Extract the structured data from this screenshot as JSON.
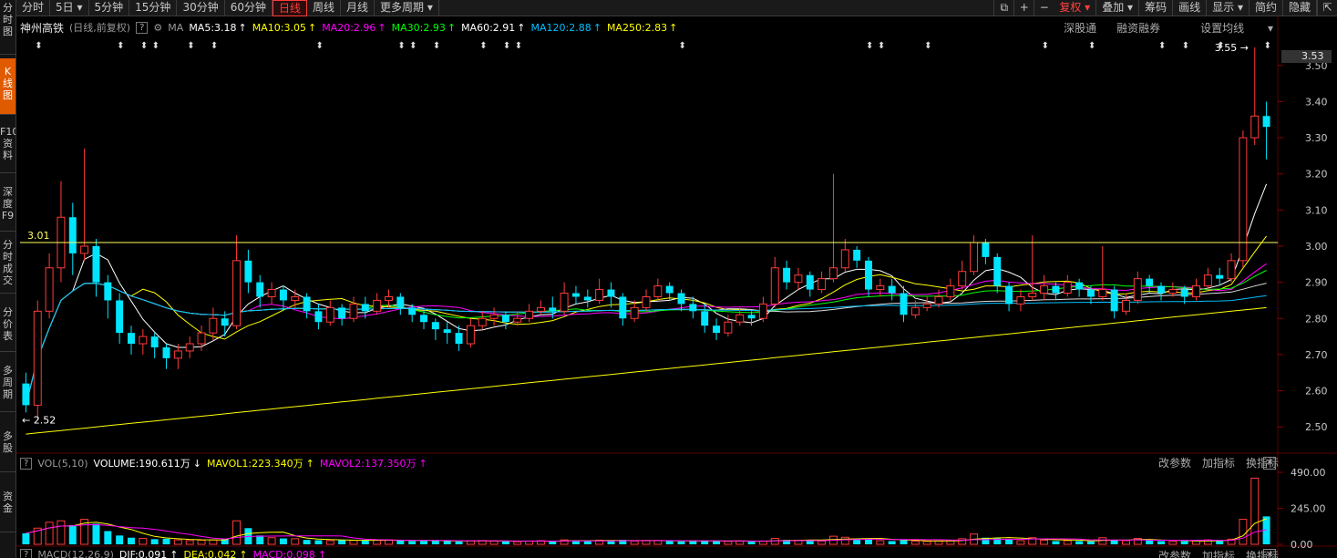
{
  "toolbar": {
    "tabs": [
      "分时",
      "5日",
      "5分钟",
      "15分钟",
      "30分钟",
      "60分钟",
      "日线",
      "周线",
      "月线",
      "更多周期"
    ],
    "active_tab": "日线",
    "right_buttons": [
      "复权",
      "叠加",
      "筹码",
      "画线",
      "显示",
      "简约",
      "隐藏"
    ],
    "accent": "#ff3b3b"
  },
  "sidebar": {
    "tabs": [
      "分时图",
      "K线图",
      "F10资料",
      "深度F9",
      "分时成交",
      "分价表",
      "多周期",
      "多股",
      "资金"
    ],
    "active": "K线图"
  },
  "info": {
    "stock_name": "神州高铁",
    "period": "(日线,前复权)",
    "ma_label": "MA",
    "ma5": "MA5:3.18",
    "ma10": "MA10:3.05",
    "ma20": "MA20:2.96",
    "ma30": "MA30:2.93",
    "ma60": "MA60:2.91",
    "ma120": "MA120:2.88",
    "ma250": "MA250:2.83",
    "right_links": [
      "深股通",
      "融资融券",
      "设置均线"
    ]
  },
  "colors": {
    "up": "#ff3b3b",
    "down": "#00e5ff",
    "ma5": "#ffffff",
    "ma10": "#ffff00",
    "ma20": "#ff00ff",
    "ma30": "#00ff00",
    "ma60": "#ffffff",
    "ma120": "#00bfff",
    "ma250": "#ffff00",
    "hline": "#ffff60"
  },
  "price_panel": {
    "y_ticks": [
      "3.50",
      "3.40",
      "3.30",
      "3.20",
      "3.10",
      "3.00",
      "2.90",
      "2.80",
      "2.70",
      "2.60",
      "2.50"
    ],
    "current_price": "3.53",
    "high_label": "3.55",
    "low_label": "2.52",
    "hline_label": "3.01"
  },
  "vol_panel": {
    "name": "VOL(5,10)",
    "volume": "VOLUME:190.611万",
    "mavol1": "MAVOL1:223.340万",
    "mavol2": "MAVOL2:137.350万",
    "y_ticks": [
      "490.00",
      "245.00",
      "0.00"
    ],
    "links": [
      "改参数",
      "加指标",
      "换指标"
    ]
  },
  "macd_panel": {
    "name": "MACD(12,26,9)",
    "dif": "DIF:0.091",
    "dea": "DEA:0.042",
    "macd": "MACD:0.098",
    "links": [
      "改参数",
      "加指标",
      "换指标"
    ]
  },
  "chart_data": {
    "type": "candlestick",
    "price_range": [
      2.45,
      3.56
    ],
    "volume_range": [
      0,
      490
    ],
    "candles": [
      [
        2.62,
        2.56,
        2.65,
        2.54
      ],
      [
        2.56,
        2.82,
        2.85,
        2.52
      ],
      [
        2.82,
        2.94,
        2.98,
        2.8
      ],
      [
        2.94,
        3.08,
        3.18,
        2.9
      ],
      [
        3.08,
        2.98,
        3.12,
        2.92
      ],
      [
        2.98,
        3.0,
        3.27,
        2.96
      ],
      [
        3.0,
        2.9,
        3.02,
        2.86
      ],
      [
        2.9,
        2.85,
        2.92,
        2.8
      ],
      [
        2.85,
        2.76,
        2.87,
        2.73
      ],
      [
        2.76,
        2.73,
        2.78,
        2.7
      ],
      [
        2.73,
        2.75,
        2.77,
        2.7
      ],
      [
        2.75,
        2.72,
        2.76,
        2.69
      ],
      [
        2.72,
        2.69,
        2.73,
        2.66
      ],
      [
        2.69,
        2.71,
        2.73,
        2.66
      ],
      [
        2.71,
        2.73,
        2.75,
        2.69
      ],
      [
        2.73,
        2.76,
        2.78,
        2.71
      ],
      [
        2.76,
        2.8,
        2.83,
        2.74
      ],
      [
        2.8,
        2.78,
        2.82,
        2.75
      ],
      [
        2.78,
        2.96,
        3.03,
        2.77
      ],
      [
        2.96,
        2.9,
        2.99,
        2.87
      ],
      [
        2.9,
        2.86,
        2.92,
        2.83
      ],
      [
        2.86,
        2.88,
        2.9,
        2.84
      ],
      [
        2.88,
        2.85,
        2.89,
        2.82
      ],
      [
        2.85,
        2.86,
        2.88,
        2.83
      ],
      [
        2.86,
        2.82,
        2.87,
        2.8
      ],
      [
        2.82,
        2.79,
        2.84,
        2.77
      ],
      [
        2.79,
        2.83,
        2.85,
        2.78
      ],
      [
        2.83,
        2.8,
        2.84,
        2.78
      ],
      [
        2.8,
        2.84,
        2.86,
        2.79
      ],
      [
        2.84,
        2.82,
        2.86,
        2.8
      ],
      [
        2.82,
        2.85,
        2.87,
        2.81
      ],
      [
        2.85,
        2.86,
        2.88,
        2.83
      ],
      [
        2.86,
        2.83,
        2.87,
        2.81
      ],
      [
        2.83,
        2.81,
        2.84,
        2.79
      ],
      [
        2.81,
        2.79,
        2.83,
        2.77
      ],
      [
        2.79,
        2.77,
        2.8,
        2.74
      ],
      [
        2.77,
        2.76,
        2.79,
        2.73
      ],
      [
        2.76,
        2.73,
        2.78,
        2.71
      ],
      [
        2.73,
        2.78,
        2.8,
        2.72
      ],
      [
        2.78,
        2.8,
        2.82,
        2.77
      ],
      [
        2.8,
        2.81,
        2.83,
        2.78
      ],
      [
        2.81,
        2.79,
        2.82,
        2.77
      ],
      [
        2.79,
        2.8,
        2.82,
        2.78
      ],
      [
        2.8,
        2.82,
        2.84,
        2.79
      ],
      [
        2.82,
        2.83,
        2.85,
        2.81
      ],
      [
        2.83,
        2.82,
        2.86,
        2.8
      ],
      [
        2.82,
        2.87,
        2.9,
        2.81
      ],
      [
        2.87,
        2.86,
        2.89,
        2.84
      ],
      [
        2.86,
        2.85,
        2.88,
        2.83
      ],
      [
        2.85,
        2.88,
        2.91,
        2.84
      ],
      [
        2.88,
        2.86,
        2.9,
        2.83
      ],
      [
        2.86,
        2.8,
        2.87,
        2.78
      ],
      [
        2.8,
        2.83,
        2.85,
        2.79
      ],
      [
        2.83,
        2.86,
        2.88,
        2.82
      ],
      [
        2.86,
        2.89,
        2.91,
        2.85
      ],
      [
        2.89,
        2.87,
        2.9,
        2.85
      ],
      [
        2.87,
        2.84,
        2.88,
        2.82
      ],
      [
        2.84,
        2.82,
        2.86,
        2.8
      ],
      [
        2.82,
        2.78,
        2.84,
        2.76
      ],
      [
        2.78,
        2.76,
        2.8,
        2.74
      ],
      [
        2.76,
        2.79,
        2.81,
        2.75
      ],
      [
        2.79,
        2.81,
        2.83,
        2.78
      ],
      [
        2.81,
        2.8,
        2.82,
        2.78
      ],
      [
        2.8,
        2.84,
        2.86,
        2.79
      ],
      [
        2.84,
        2.94,
        2.97,
        2.83
      ],
      [
        2.94,
        2.9,
        2.96,
        2.88
      ],
      [
        2.9,
        2.92,
        2.94,
        2.88
      ],
      [
        2.92,
        2.88,
        2.93,
        2.86
      ],
      [
        2.88,
        2.91,
        2.93,
        2.87
      ],
      [
        2.91,
        2.94,
        3.2,
        2.9
      ],
      [
        2.94,
        2.99,
        3.02,
        2.93
      ],
      [
        2.99,
        2.96,
        3.0,
        2.94
      ],
      [
        2.96,
        2.88,
        2.97,
        2.86
      ],
      [
        2.88,
        2.89,
        2.91,
        2.86
      ],
      [
        2.89,
        2.87,
        2.91,
        2.85
      ],
      [
        2.87,
        2.81,
        2.89,
        2.79
      ],
      [
        2.81,
        2.83,
        2.85,
        2.8
      ],
      [
        2.83,
        2.84,
        2.86,
        2.82
      ],
      [
        2.84,
        2.86,
        2.88,
        2.83
      ],
      [
        2.86,
        2.89,
        2.91,
        2.85
      ],
      [
        2.89,
        2.93,
        2.96,
        2.88
      ],
      [
        2.93,
        3.01,
        3.03,
        2.92
      ],
      [
        3.01,
        2.97,
        3.02,
        2.95
      ],
      [
        2.97,
        2.89,
        2.98,
        2.87
      ],
      [
        2.89,
        2.84,
        2.9,
        2.82
      ],
      [
        2.84,
        2.86,
        2.88,
        2.82
      ],
      [
        2.86,
        2.87,
        3.03,
        2.85
      ],
      [
        2.87,
        2.89,
        2.92,
        2.85
      ],
      [
        2.89,
        2.87,
        2.9,
        2.85
      ],
      [
        2.87,
        2.9,
        2.92,
        2.86
      ],
      [
        2.9,
        2.88,
        2.91,
        2.86
      ],
      [
        2.88,
        2.86,
        2.89,
        2.84
      ],
      [
        2.86,
        2.88,
        3.0,
        2.85
      ],
      [
        2.88,
        2.82,
        2.89,
        2.8
      ],
      [
        2.82,
        2.85,
        2.87,
        2.81
      ],
      [
        2.85,
        2.91,
        2.93,
        2.84
      ],
      [
        2.91,
        2.89,
        2.92,
        2.87
      ],
      [
        2.89,
        2.87,
        2.9,
        2.85
      ],
      [
        2.87,
        2.88,
        2.9,
        2.86
      ],
      [
        2.88,
        2.86,
        2.89,
        2.84
      ],
      [
        2.86,
        2.89,
        2.91,
        2.85
      ],
      [
        2.89,
        2.92,
        2.94,
        2.88
      ],
      [
        2.92,
        2.91,
        2.94,
        2.89
      ],
      [
        2.91,
        2.96,
        2.98,
        2.9
      ],
      [
        2.96,
        3.3,
        3.32,
        2.94
      ],
      [
        3.3,
        3.36,
        3.55,
        3.28
      ],
      [
        3.36,
        3.33,
        3.4,
        3.24
      ]
    ],
    "volumes": [
      75,
      110,
      150,
      160,
      130,
      170,
      140,
      90,
      60,
      45,
      40,
      35,
      38,
      30,
      25,
      28,
      30,
      35,
      160,
      110,
      60,
      45,
      40,
      38,
      30,
      28,
      25,
      30,
      27,
      25,
      28,
      30,
      25,
      22,
      24,
      28,
      22,
      20,
      24,
      26,
      22,
      20,
      18,
      22,
      25,
      20,
      30,
      26,
      22,
      28,
      25,
      30,
      22,
      24,
      26,
      22,
      20,
      22,
      26,
      24,
      20,
      22,
      18,
      22,
      40,
      30,
      28,
      25,
      22,
      55,
      48,
      35,
      40,
      25,
      22,
      30,
      22,
      20,
      22,
      25,
      38,
      70,
      45,
      40,
      35,
      25,
      45,
      28,
      22,
      25,
      22,
      20,
      45,
      30,
      25,
      40,
      28,
      22,
      20,
      22,
      25,
      30,
      28,
      35,
      170,
      450,
      190
    ]
  }
}
